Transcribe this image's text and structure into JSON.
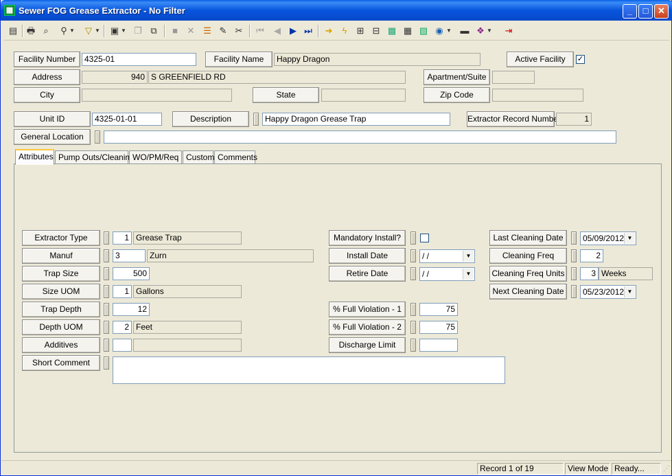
{
  "window": {
    "title": "Sewer FOG Grease Extractor - No Filter",
    "minimize": "_",
    "maximize": "□",
    "close": "✕"
  },
  "toolbar": {
    "icons": [
      "grid-icon",
      "print-icon",
      "print-preview-icon",
      "binoculars-icon",
      "filter-icon",
      "new-record-icon",
      "copy-icon",
      "paste-icon",
      "save-icon",
      "delete-icon",
      "stack-icon",
      "edit-icon",
      "cut-icon",
      "first-record-icon",
      "previous-record-icon",
      "next-record-icon",
      "last-record-icon",
      "goto-icon",
      "lightning-icon",
      "tree-icon",
      "map-icon",
      "calc-icon",
      "chart-icon",
      "globe-icon",
      "keyboard-icon",
      "books-icon",
      "exit-icon"
    ]
  },
  "header": {
    "facility_number_label": "Facility Number",
    "facility_number": "4325-01",
    "facility_name_label": "Facility Name",
    "facility_name": "Happy Dragon",
    "active_facility_label": "Active Facility",
    "active_facility_checked": "✓",
    "address_label": "Address",
    "address_number": "940",
    "address_street": "S GREENFIELD RD",
    "apartment_label": "Apartment/Suite",
    "apartment": "",
    "city_label": "City",
    "city": "",
    "state_label": "State",
    "state": "",
    "zip_label": "Zip Code",
    "zip": "",
    "unit_id_label": "Unit ID",
    "unit_id": "4325-01-01",
    "description_label": "Description",
    "description": "Happy Dragon Grease Trap",
    "extractor_record_label": "Extractor Record Number",
    "extractor_record": "1",
    "general_location_label": "General Location",
    "general_location": ""
  },
  "tabs": [
    {
      "label": "Attributes"
    },
    {
      "label": "Pump Outs/Cleaning"
    },
    {
      "label": "WO/PM/Req"
    },
    {
      "label": "Custom"
    },
    {
      "label": "Comments"
    }
  ],
  "attributes": {
    "extractor_type_label": "Extractor Type",
    "extractor_type_code": "1",
    "extractor_type": "Grease Trap",
    "manuf_label": "Manuf",
    "manuf_code": "3",
    "manuf": "Zurn",
    "trap_size_label": "Trap Size",
    "trap_size": "500",
    "size_uom_label": "Size UOM",
    "size_uom_code": "1",
    "size_uom": "Gallons",
    "trap_depth_label": "Trap Depth",
    "trap_depth": "12",
    "depth_uom_label": "Depth UOM",
    "depth_uom_code": "2",
    "depth_uom": "Feet",
    "additives_label": "Additives",
    "additives_code": "",
    "additives": "",
    "short_comment_label": "Short Comment",
    "short_comment": "",
    "mandatory_install_label": "Mandatory Install?",
    "install_date_label": "Install Date",
    "install_date": " /  /",
    "retire_date_label": "Retire Date",
    "retire_date": " /  /",
    "full_violation_1_label": "% Full Violation - 1",
    "full_violation_1": "75",
    "full_violation_2_label": "% Full Violation - 2",
    "full_violation_2": "75",
    "discharge_limit_label": "Discharge Limit",
    "discharge_limit": "",
    "last_cleaning_label": "Last Cleaning Date",
    "last_cleaning": "05/09/2012",
    "cleaning_freq_label": "Cleaning Freq",
    "cleaning_freq": "2",
    "cleaning_freq_units_label": "Cleaning Freq Units",
    "cleaning_freq_units_code": "3",
    "cleaning_freq_units": "Weeks",
    "next_cleaning_label": "Next Cleaning Date",
    "next_cleaning": "05/23/2012"
  },
  "status": {
    "record": "Record 1 of 19",
    "mode": "View Mode",
    "state": "Ready..."
  }
}
